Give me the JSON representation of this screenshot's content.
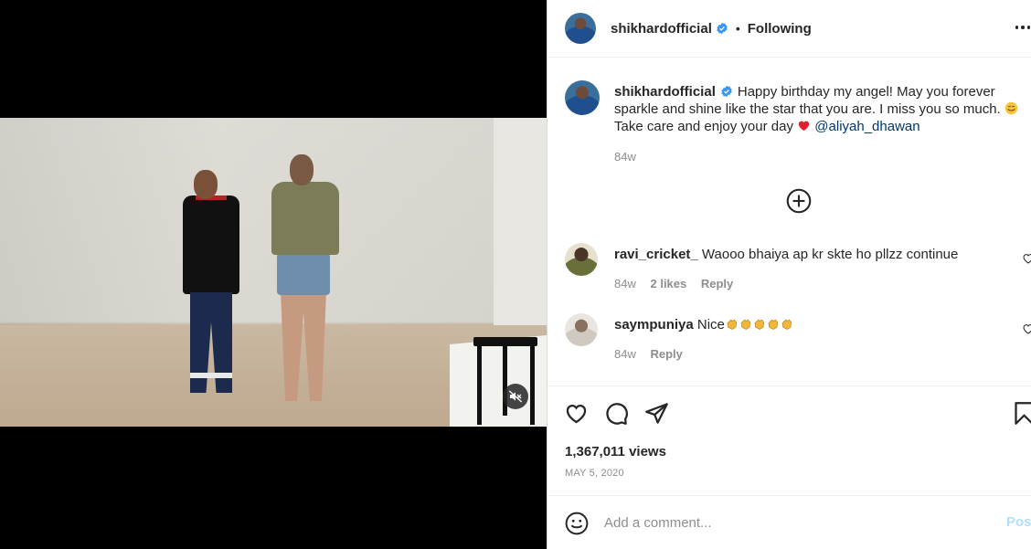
{
  "post": {
    "username": "shikhardofficial",
    "follow_status": "Following",
    "separator": "•"
  },
  "caption": {
    "username": "shikhardofficial",
    "text": "Happy birthday my angel! May you forever sparkle and shine like the star that you are. I miss you so much.",
    "text2": "Take care and enjoy your day",
    "mention": "@aliyah_dhawan",
    "time": "84w"
  },
  "comments": [
    {
      "username": "ravi_cricket_",
      "text": "Waooo bhaiya ap kr skte ho pllzz continue",
      "time": "84w",
      "likes": "2 likes",
      "reply": "Reply"
    },
    {
      "username": "saympuniya",
      "text": "Nice",
      "time": "84w",
      "reply": "Reply"
    }
  ],
  "stats": {
    "views": "1,367,011 views",
    "date": "MAY 5, 2020"
  },
  "composer": {
    "placeholder": "Add a comment...",
    "post_label": "Post"
  },
  "icons": [
    "verified-badge-icon",
    "more-options-icon",
    "load-more-comments-icon",
    "heart-icon",
    "comment-icon",
    "share-icon",
    "save-icon",
    "emoji-icon",
    "mute-icon",
    "clapping-hands-icon",
    "red-heart-icon",
    "smiling-face-icon"
  ],
  "colors": {
    "verified": "#3897f0",
    "mention": "#00376b",
    "post_disabled": "#b2dffc",
    "meta": "#8e8e8e"
  }
}
